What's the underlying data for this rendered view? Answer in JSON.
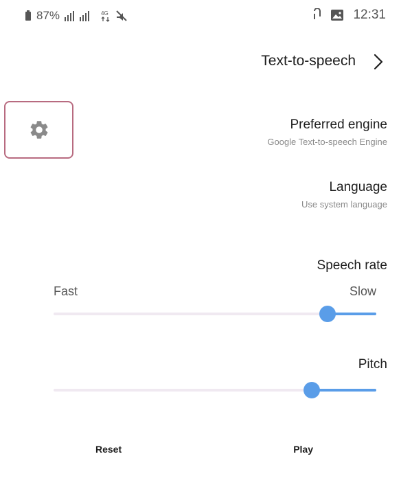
{
  "status_bar": {
    "time": "12:31",
    "battery": "87%",
    "icons_right": [
      "image-icon",
      "link-icon"
    ],
    "icons_left": [
      "battery-icon",
      "signal-icon",
      "network-4g-icon",
      "mute-icon"
    ]
  },
  "header": {
    "title": "Text-to-speech"
  },
  "settings": {
    "preferred_engine": {
      "title": "Preferred engine",
      "subtitle": "Google Text-to-speech Engine"
    },
    "language": {
      "title": "Language",
      "subtitle": "Use system language"
    }
  },
  "speech_rate": {
    "title": "Speech rate",
    "label_slow": "Slow",
    "label_fast": "Fast",
    "value_fraction": 0.15
  },
  "pitch": {
    "title": "Pitch",
    "value_fraction": 0.2
  },
  "footer": {
    "play": "Play",
    "reset": "Reset"
  },
  "colors": {
    "accent": "#5a9de8",
    "highlight_border": "#b86b80",
    "track": "#f0e9f1"
  }
}
